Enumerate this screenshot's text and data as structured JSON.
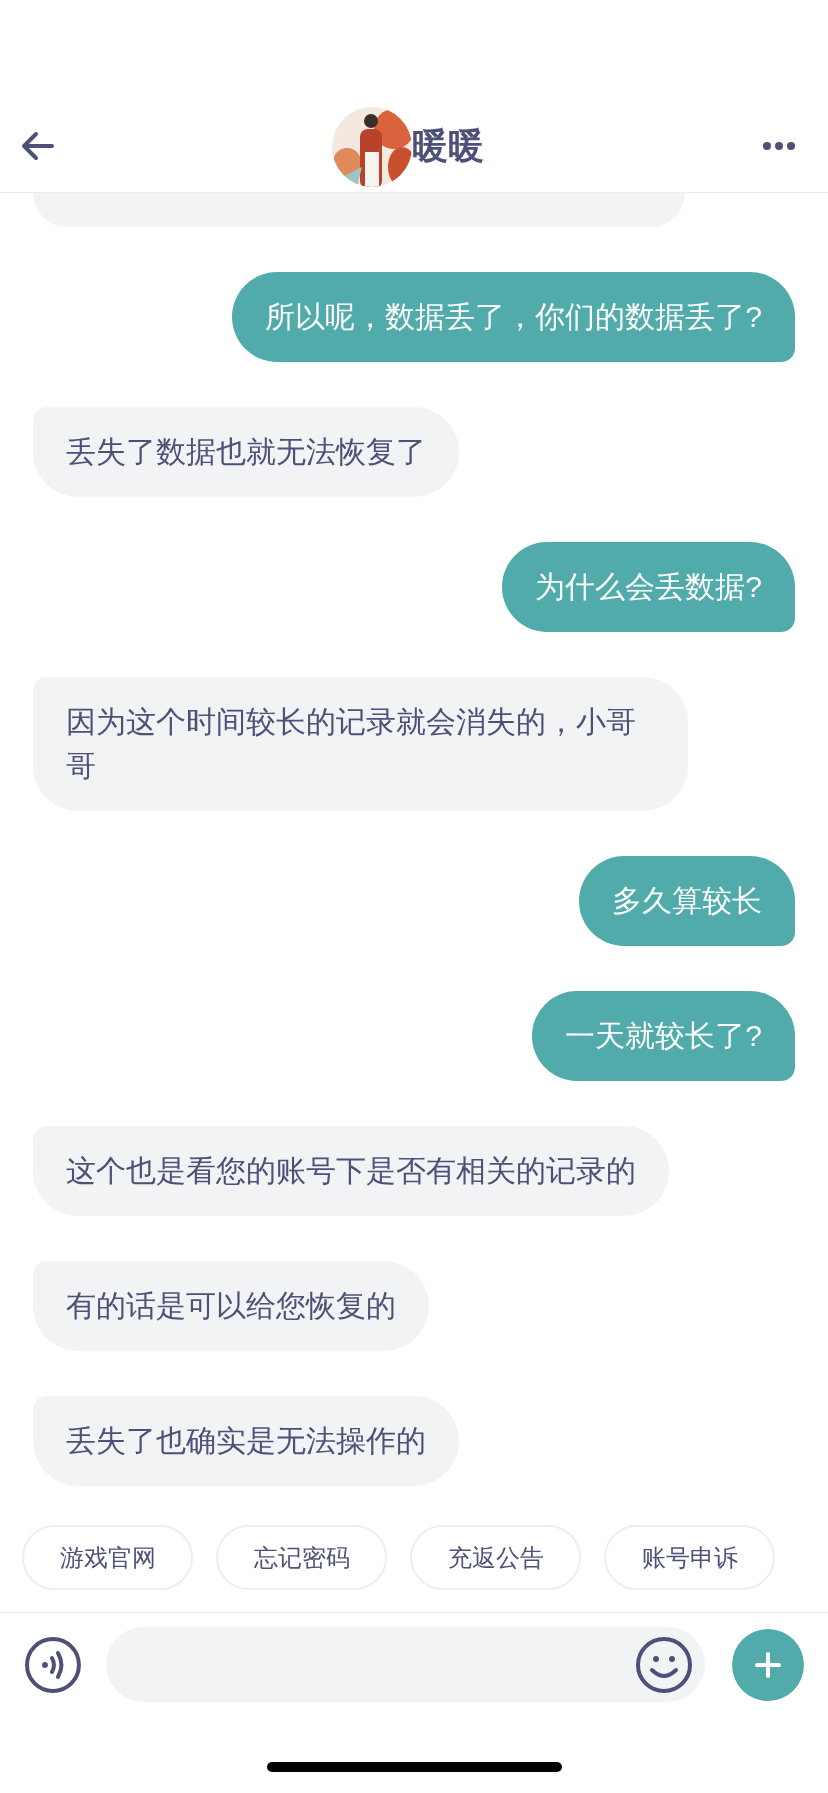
{
  "header": {
    "title": "暖暖"
  },
  "clipped_bubble": {
    "kind": "received"
  },
  "messages": [
    {
      "kind": "sent",
      "text": "所以呢，数据丢了，你们的数据丢了?"
    },
    {
      "kind": "received",
      "text": "丢失了数据也就无法恢复了"
    },
    {
      "kind": "sent",
      "text": "为什么会丢数据?"
    },
    {
      "kind": "received",
      "text": "因为这个时间较长的记录就会消失的，小哥哥"
    },
    {
      "kind": "sent",
      "text": "多久算较长"
    },
    {
      "kind": "sent",
      "text": "一天就较长了?"
    },
    {
      "kind": "received",
      "text": "这个也是看您的账号下是否有相关的记录的"
    },
    {
      "kind": "received",
      "text": "有的话是可以给您恢复的"
    },
    {
      "kind": "received",
      "text": "丢失了也确实是无法操作的"
    }
  ],
  "quick_replies": [
    "游戏官网",
    "忘记密码",
    "充返公告",
    "账号申诉"
  ]
}
